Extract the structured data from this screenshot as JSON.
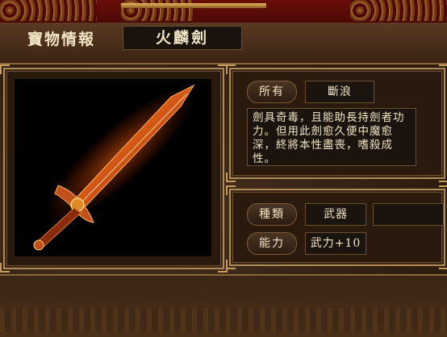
{
  "header": {
    "title_label": "寶物情報",
    "item_name": "火麟劍"
  },
  "info": {
    "owner_label": "所有",
    "owner_value": "斷浪",
    "description": "劍具奇毒，且能助長持劍者功力。但用此劍愈久便中魔愈深，終將本性盡喪，嗜殺成性。"
  },
  "stats": {
    "type_label": "種類",
    "type_value": "武器",
    "power_label": "能力",
    "power_value": "武力+10"
  },
  "colors": {
    "panel": "#2e1d12",
    "frame_gold": "#b08a55",
    "text": "#f1e4c4",
    "image_bg": "#000000",
    "top_red": "#6a0f0a"
  },
  "icons": {
    "item_picture": "flame-sword-illustration"
  }
}
